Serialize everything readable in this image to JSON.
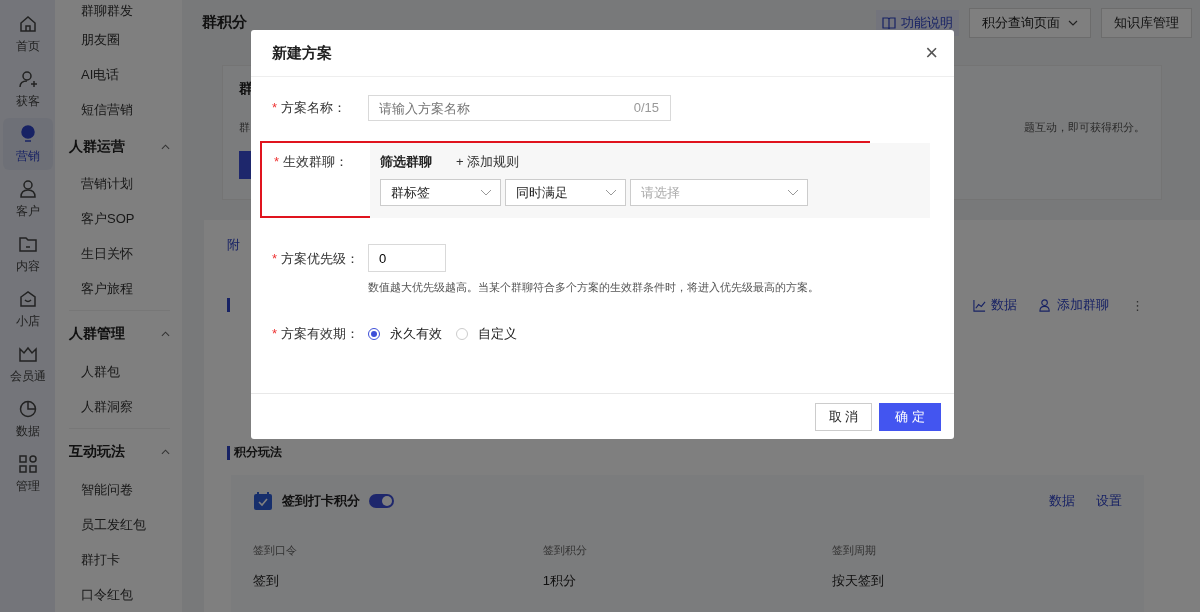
{
  "rail": {
    "items": [
      {
        "label": "首页",
        "selected": false
      },
      {
        "label": "获客",
        "selected": false
      },
      {
        "label": "营销",
        "selected": true
      },
      {
        "label": "客户",
        "selected": false
      },
      {
        "label": "内容",
        "selected": false
      },
      {
        "label": "小店",
        "selected": false
      },
      {
        "label": "会员通",
        "selected": false
      },
      {
        "label": "数据",
        "selected": false
      },
      {
        "label": "管理",
        "selected": false
      }
    ]
  },
  "sidebar": {
    "items": [
      "群聊群发",
      "朋友圈",
      "AI电话",
      "短信营销"
    ],
    "groups": [
      {
        "title": "人群运营",
        "expanded": true,
        "items": [
          "营销计划",
          "客户SOP",
          "生日关怀",
          "客户旅程"
        ]
      },
      {
        "title": "人群管理",
        "expanded": true,
        "items": [
          "人群包",
          "人群洞察"
        ]
      },
      {
        "title": "互动玩法",
        "expanded": true,
        "items": [
          "智能问卷",
          "员工发红包",
          "群打卡",
          "口令红包"
        ]
      }
    ]
  },
  "header": {
    "title": "群积分",
    "help_link": "功能说明",
    "dropdown": "积分查询页面",
    "button": "知识库管理"
  },
  "intro_card": {
    "title": "群",
    "text_left": "群",
    "text_right": "题互动，即可获得积分。"
  },
  "panel": {
    "tab": "附",
    "actions": [
      "数据",
      "添加群聊"
    ],
    "more": "⋮"
  },
  "play": {
    "title": "积分玩法",
    "item": {
      "name": "签到打卡积分",
      "on": true,
      "links": [
        "数据",
        "设置"
      ],
      "columns": [
        {
          "label": "签到口令",
          "value": "签到"
        },
        {
          "label": "签到积分",
          "value": "1积分"
        },
        {
          "label": "签到周期",
          "value": "按天签到"
        }
      ]
    }
  },
  "modal": {
    "title": "新建方案",
    "close": "×",
    "name_field": {
      "mark": "*",
      "label": "方案名称：",
      "placeholder": "请输入方案名称",
      "counter": "0/15"
    },
    "group_field": {
      "mark": "*",
      "label": "生效群聊：",
      "highlighted": true,
      "filter_title": "筛选群聊",
      "add_rule": "+ 添加规则",
      "selects": [
        {
          "value": "群标签"
        },
        {
          "value": "同时满足"
        },
        {
          "placeholder": "请选择"
        }
      ]
    },
    "priority_field": {
      "mark": "*",
      "label": "方案优先级：",
      "value": "0",
      "hint": "数值越大优先级越高。当某个群聊符合多个方案的生效群条件时，将进入优先级最高的方案。"
    },
    "validity_field": {
      "mark": "*",
      "label": "方案有效期：",
      "options": [
        {
          "label": "永久有效",
          "selected": true
        },
        {
          "label": "自定义",
          "selected": false
        }
      ]
    },
    "buttons": [
      {
        "label": "取 消",
        "kind": "secondary"
      },
      {
        "label": "确 定",
        "kind": "primary"
      }
    ]
  }
}
